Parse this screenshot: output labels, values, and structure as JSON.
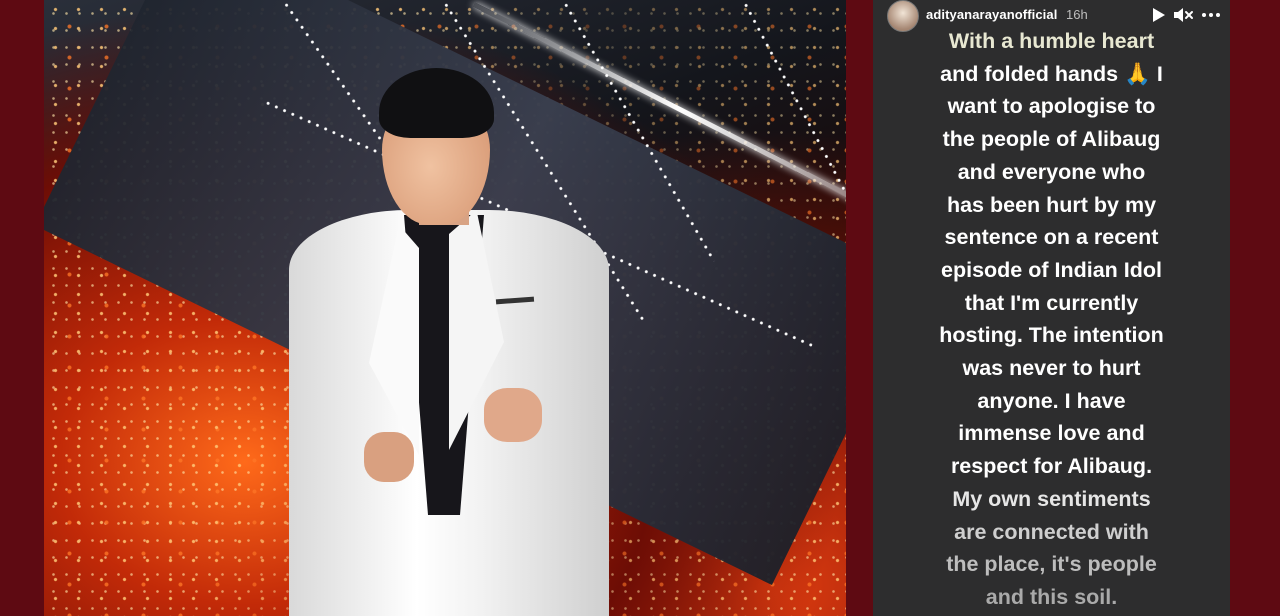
{
  "story": {
    "username": "adityanarayanofficial",
    "time": "16h",
    "icons": {
      "play": "play-icon",
      "mute": "mute-icon",
      "more": "more-icon"
    },
    "lines": [
      "With a humble heart",
      "and folded hands 🙏 I",
      "want to apologise to",
      "the people of Alibaug",
      "and everyone who",
      "has been hurt by my",
      "sentence on a recent",
      "episode of Indian Idol",
      "that I'm currently",
      "hosting. The intention",
      "was never to hurt",
      "anyone. I have",
      "immense love and",
      "respect for Alibaug.",
      "My own sentiments",
      "are connected with",
      "the place, it's people",
      "and this soil."
    ],
    "line_colors": [
      "#e8e8d2",
      "#ffffff",
      "#ffffff",
      "#ffffff",
      "#ffffff",
      "#ffffff",
      "#ffffff",
      "#ffffff",
      "#ffffff",
      "#ffffff",
      "#ffffff",
      "#ffffff",
      "#ffffff",
      "#ffffff",
      "#e6e6e6",
      "#cfcfcf",
      "#bdbdbd",
      "#aaaaaa"
    ]
  },
  "colors": {
    "background": "#5e0a12",
    "story_panel": "#2d2d2e"
  }
}
